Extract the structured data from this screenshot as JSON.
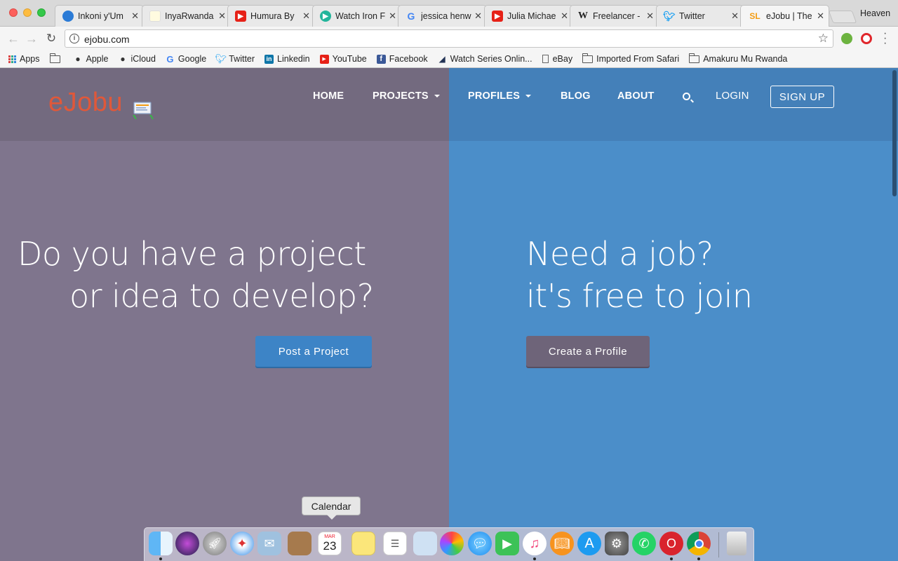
{
  "browser": {
    "tabs": [
      {
        "label": "Inkoni y'Um",
        "icon": "edge-icon",
        "color": "#2b7bd6"
      },
      {
        "label": "InyaRwanda",
        "icon": "inyarwanda-icon",
        "color": "#f0e68c"
      },
      {
        "label": "Humura By",
        "icon": "youtube-icon",
        "color": "#e62117"
      },
      {
        "label": "Watch Iron F",
        "icon": "play-icon",
        "color": "#23b59b"
      },
      {
        "label": "jessica henw",
        "icon": "google-icon",
        "color": "#4285f4"
      },
      {
        "label": "Julia Michae",
        "icon": "youtube-icon",
        "color": "#e62117"
      },
      {
        "label": "Freelancer -",
        "icon": "wikipedia-icon",
        "color": "#ffffff"
      },
      {
        "label": "Twitter",
        "icon": "twitter-icon",
        "color": "#1da1f2"
      },
      {
        "label": "eJobu | The",
        "icon": "sl-icon",
        "color": "#f39c12"
      }
    ],
    "profile_name": "Heaven",
    "url": "ejobu.com",
    "bookmarks": [
      {
        "label": "Apps",
        "icon": "apps-grid-icon"
      },
      {
        "label": "",
        "icon": "folder-icon"
      },
      {
        "label": "Apple",
        "icon": "apple-icon"
      },
      {
        "label": "iCloud",
        "icon": "apple-icon"
      },
      {
        "label": "Google",
        "icon": "google-icon"
      },
      {
        "label": "Twitter",
        "icon": "twitter-icon"
      },
      {
        "label": "Linkedin",
        "icon": "linkedin-icon"
      },
      {
        "label": "YouTube",
        "icon": "youtube-icon"
      },
      {
        "label": "Facebook",
        "icon": "facebook-icon"
      },
      {
        "label": "Watch Series Onlin...",
        "icon": "watchseries-icon"
      },
      {
        "label": "eBay",
        "icon": "page-icon"
      },
      {
        "label": "Imported From Safari",
        "icon": "folder-icon"
      },
      {
        "label": "Amakuru Mu Rwanda",
        "icon": "folder-icon"
      }
    ]
  },
  "site": {
    "logo": "eJobu",
    "nav": {
      "home": "HOME",
      "projects": "PROJECTS",
      "profiles": "PROFILES",
      "blog": "BLOG",
      "about": "ABOUT",
      "login": "LOGIN",
      "signup": "SIGN UP"
    },
    "left": {
      "headline_1": "Do you have a project",
      "headline_2": "or idea to develop?",
      "cta": "Post a Project"
    },
    "right": {
      "headline_1": "Need a job?",
      "headline_2": "it's free to join",
      "cta": "Create a Profile"
    },
    "colors": {
      "left_panel": "#7f758d",
      "right_panel": "#4b8ec9",
      "logo": "#e0583a",
      "post_button": "#3d84c6",
      "profile_button": "#6e6479"
    }
  },
  "dock": {
    "tooltip": "Calendar",
    "calendar_month": "MAR",
    "calendar_day": "23",
    "apps": [
      "finder-icon",
      "siri-icon",
      "launchpad-icon",
      "safari-icon",
      "mail-icon",
      "contacts-icon",
      "calendar-icon",
      "notes-icon",
      "reminders-icon",
      "preview-icon",
      "photos-icon",
      "messages-icon",
      "facetime-icon",
      "itunes-icon",
      "ibooks-icon",
      "app-store-icon",
      "system-preferences-icon",
      "whatsapp-icon",
      "opera-icon",
      "chrome-icon",
      "trash-icon"
    ]
  }
}
